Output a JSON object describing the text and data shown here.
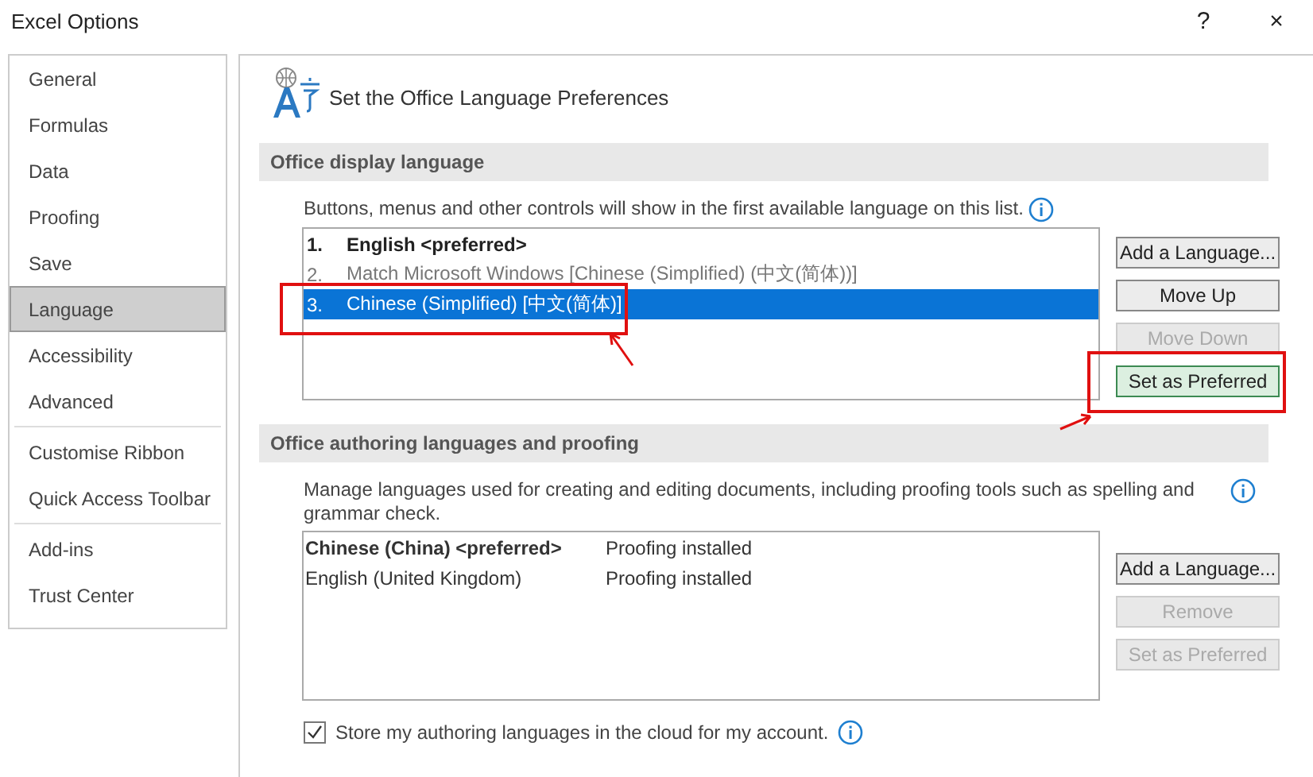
{
  "window": {
    "title": "Excel Options",
    "help": "?",
    "close": "×"
  },
  "sidebar": {
    "items": [
      {
        "label": "General",
        "selected": false,
        "divider_after": false
      },
      {
        "label": "Formulas",
        "selected": false,
        "divider_after": false
      },
      {
        "label": "Data",
        "selected": false,
        "divider_after": false
      },
      {
        "label": "Proofing",
        "selected": false,
        "divider_after": false
      },
      {
        "label": "Save",
        "selected": false,
        "divider_after": false
      },
      {
        "label": "Language",
        "selected": true,
        "divider_after": false
      },
      {
        "label": "Accessibility",
        "selected": false,
        "divider_after": false
      },
      {
        "label": "Advanced",
        "selected": false,
        "divider_after": true
      },
      {
        "label": "Customise Ribbon",
        "selected": false,
        "divider_after": false
      },
      {
        "label": "Quick Access Toolbar",
        "selected": false,
        "divider_after": true
      },
      {
        "label": "Add-ins",
        "selected": false,
        "divider_after": false
      },
      {
        "label": "Trust Center",
        "selected": false,
        "divider_after": false
      }
    ]
  },
  "page": {
    "title": "Set the Office Language Preferences"
  },
  "display_section": {
    "heading": "Office display language",
    "description": "Buttons, menus and other controls will show in the first available language on this list.",
    "languages": [
      {
        "number": "1.",
        "name": "English <preferred>",
        "preferred": true,
        "available": true,
        "selected": false
      },
      {
        "number": "2.",
        "name": "Match Microsoft Windows [Chinese (Simplified) (中文(简体))]",
        "preferred": false,
        "available": false,
        "selected": false
      },
      {
        "number": "3.",
        "name": "Chinese (Simplified) [中文(简体)]",
        "preferred": false,
        "available": true,
        "selected": true
      }
    ],
    "buttons": [
      {
        "label": "Add a Language...",
        "disabled": false,
        "default": false
      },
      {
        "label": "Move Up",
        "disabled": false,
        "default": false
      },
      {
        "label": "Move Down",
        "disabled": true,
        "default": false
      },
      {
        "label": "Set as Preferred",
        "disabled": false,
        "default": true
      }
    ]
  },
  "authoring_section": {
    "heading": "Office authoring languages and proofing",
    "description": "Manage languages used for creating and editing documents, including proofing tools such as spelling and grammar check.",
    "languages": [
      {
        "name": "Chinese (China) <preferred>",
        "status": "Proofing installed",
        "preferred": true
      },
      {
        "name": "English (United Kingdom)",
        "status": "Proofing installed",
        "preferred": false
      }
    ],
    "buttons": [
      {
        "label": "Add a Language...",
        "disabled": false,
        "default": false
      },
      {
        "label": "Remove",
        "disabled": true,
        "default": false
      },
      {
        "label": "Set as Preferred",
        "disabled": true,
        "default": false
      }
    ],
    "cloud_option": {
      "label": "Store my authoring languages in the cloud for my account.",
      "checked": true
    }
  }
}
